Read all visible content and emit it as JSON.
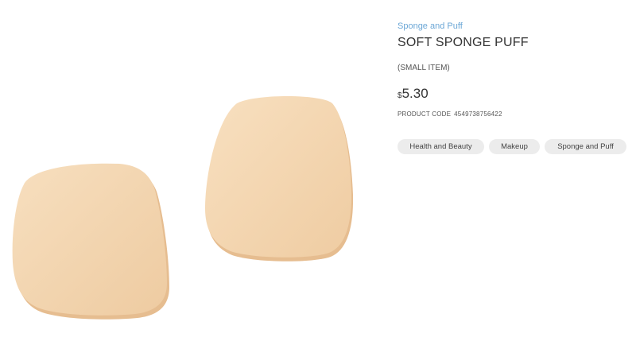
{
  "product": {
    "category_link": "Sponge and Puff",
    "title": "SOFT SPONGE PUFF",
    "size_note": "(SMALL ITEM)",
    "currency_symbol": "$",
    "price": "5.30",
    "code_label": "PRODUCT CODE",
    "code_value": "4549738756422",
    "tags": [
      "Health and Beauty",
      "Makeup",
      "Sponge and Puff"
    ]
  },
  "colors": {
    "link": "#6ba7d6",
    "tag_bg": "#ececec",
    "sponge": "#f2d5b1"
  },
  "icons": {
    "product_image": "sponge-puff-image"
  }
}
